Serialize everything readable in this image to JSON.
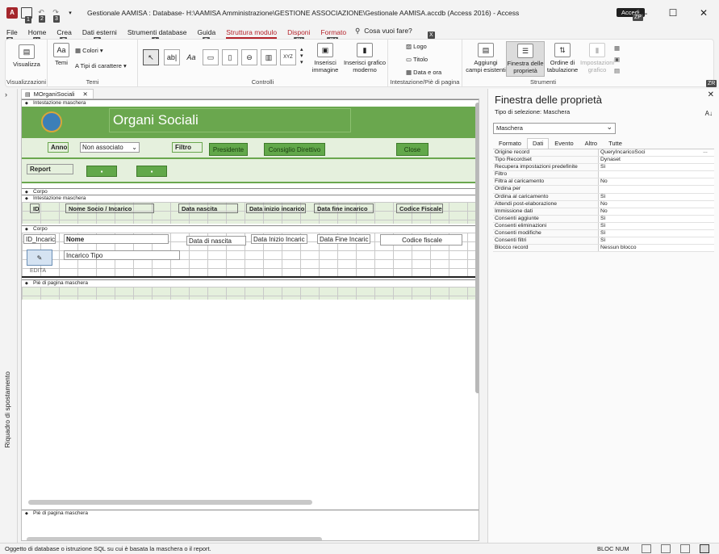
{
  "window": {
    "title": "Gestionale AAMISA : Database- H:\\AAMISA Amministrazione\\GESTIONE ASSOCIAZIONE\\Gestionale AAMISA.accdb (Access 2016) - Access",
    "account": "Accedi",
    "account_keytip": "ZP",
    "qat_keytips": [
      "1",
      "2",
      "3"
    ]
  },
  "ribbon_tabs": [
    {
      "label": "File",
      "keytip": "F"
    },
    {
      "label": "Home",
      "keytip": "H"
    },
    {
      "label": "Crea",
      "keytip": "C"
    },
    {
      "label": "Dati esterni",
      "keytip": "R"
    },
    {
      "label": "Strumenti database",
      "keytip": "A"
    },
    {
      "label": "Guida",
      "keytip": "G"
    },
    {
      "label": "Struttura modulo",
      "keytip": "JD"
    },
    {
      "label": "Disponi",
      "keytip": "JN"
    },
    {
      "label": "Formato",
      "keytip": "JM"
    }
  ],
  "tell_me": "Cosa vuoi fare?",
  "tell_me_keytip": "X",
  "ribbon": {
    "views": {
      "label": "Visualizza",
      "group": "Visualizzazioni"
    },
    "themes": {
      "temi": "Temi",
      "colori": "Colori",
      "caratteri": "Tipi di carattere",
      "group": "Temi"
    },
    "controls": {
      "group": "Controlli",
      "label_ctl": "Aa",
      "textbox_ctl": "ab|",
      "xyz_ctl": "XYZ"
    },
    "insert_image": "Inserisci immagine",
    "insert_chart": "Inserisci grafico moderno",
    "header": {
      "logo": "Logo",
      "titolo": "Titolo",
      "data": "Data e ora",
      "group": "Intestazione/Piè di pagina"
    },
    "tools": {
      "add_fields": "Aggiungi campi esistenti",
      "props": "Finestra delle proprietà",
      "tab_order": "Ordine di tabulazione",
      "chart_settings": "Impostazioni grafico",
      "group": "Strumenti"
    },
    "collapse_keytip": "ZR"
  },
  "nav_pane": {
    "label": "Riquadro di spostamento"
  },
  "document": {
    "tab": "MOrganiSociali",
    "sections": {
      "header": "Intestazione maschera",
      "detail": "Corpo",
      "footer": "Piè di pagina maschera"
    },
    "form_title": "Organi Sociali",
    "anno_label": "Anno",
    "anno_value": "Non associato",
    "filtro_label": "Filtro",
    "btn_presidente": "Presidente",
    "btn_consiglio": "Consiglio Direttivo",
    "btn_close": "Close",
    "report_label": "Report",
    "sub_headers": [
      "ID",
      "Nome Socio / Incarico",
      "Data nascita",
      "Data inizio incarico",
      "Data fine incarico",
      "Codice Fiscale"
    ],
    "sub_fields": [
      "ID_Incaric",
      "Nome",
      "Data di nascita",
      "Data Inizio Incaric",
      "Data Fine Incaric",
      "Codice fiscale"
    ],
    "sub_incarico": "Incarico Tipo",
    "edit_label": "EDITA"
  },
  "properties": {
    "title": "Finestra delle proprietà",
    "sel_type_label": "Tipo di selezione:",
    "sel_type_value": "Maschera",
    "object": "Maschera",
    "tabs": [
      "Formato",
      "Dati",
      "Evento",
      "Altro",
      "Tutte"
    ],
    "active_tab": "Dati",
    "rows": [
      {
        "k": "Origine record",
        "v": "QueryIncaricoSoci"
      },
      {
        "k": "Tipo Recordset",
        "v": "Dynaset"
      },
      {
        "k": "Recupera impostazioni predefinite",
        "v": "Sì"
      },
      {
        "k": "Filtro",
        "v": ""
      },
      {
        "k": "Filtra al caricamento",
        "v": "No"
      },
      {
        "k": "Ordina per",
        "v": ""
      },
      {
        "k": "Ordina al caricamento",
        "v": "Sì"
      },
      {
        "k": "Attendi post-elaborazione",
        "v": "No"
      },
      {
        "k": "Immissione dati",
        "v": "No"
      },
      {
        "k": "Consenti aggiunte",
        "v": "Sì"
      },
      {
        "k": "Consenti eliminazioni",
        "v": "Sì"
      },
      {
        "k": "Consenti modifiche",
        "v": "Sì"
      },
      {
        "k": "Consenti filtri",
        "v": "Sì"
      },
      {
        "k": "Blocco record",
        "v": "Nessun blocco"
      }
    ]
  },
  "status": {
    "message": "Oggetto di database o istruzione SQL su cui è basata la maschera o il report.",
    "num_lock": "BLOC NUM"
  },
  "colors": {
    "accent": "#b5232b",
    "form_green": "#6aa74e",
    "form_light": "#e5f0dd"
  }
}
